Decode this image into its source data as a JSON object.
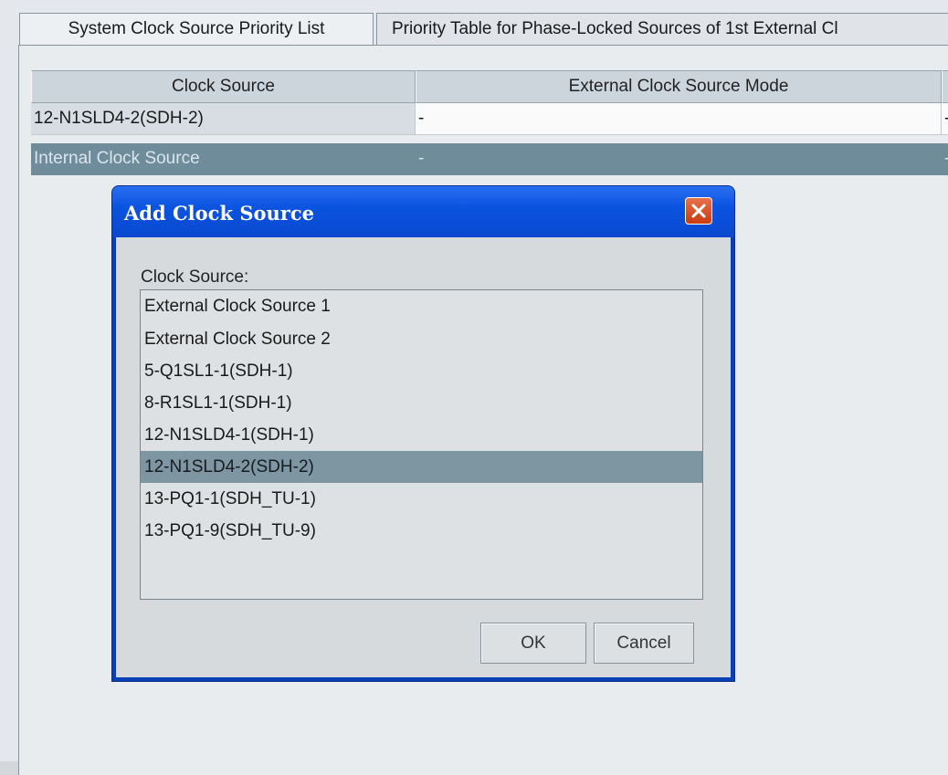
{
  "tabs": [
    {
      "label": "System Clock Source Priority List"
    },
    {
      "label": "Priority Table for Phase-Locked Sources of 1st External Cl"
    }
  ],
  "table": {
    "columns": [
      "Clock Source",
      "External Clock Source Mode"
    ],
    "rows": [
      {
        "clock_source": "12-N1SLD4-2(SDH-2)",
        "mode": "-",
        "extra": "-"
      },
      {
        "clock_source": "Internal Clock Source",
        "mode": "-",
        "extra": "-"
      }
    ]
  },
  "dialog": {
    "title": "Add Clock Source",
    "field_label": "Clock Source:",
    "options": [
      "External Clock Source 1",
      "External Clock Source 2",
      "5-Q1SL1-1(SDH-1)",
      "8-R1SL1-1(SDH-1)",
      "12-N1SLD4-1(SDH-1)",
      "12-N1SLD4-2(SDH-2)",
      "13-PQ1-1(SDH_TU-1)",
      "13-PQ1-9(SDH_TU-9)"
    ],
    "selected_option": "12-N1SLD4-2(SDH-2)",
    "ok_label": "OK",
    "cancel_label": "Cancel"
  },
  "colors": {
    "title_bar": "#0a54e0",
    "selection": "#7e95a2",
    "close_button": "#c83c10"
  },
  "icons": {
    "close": "close-icon"
  }
}
